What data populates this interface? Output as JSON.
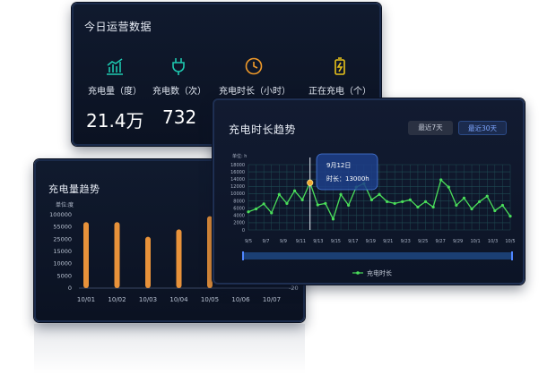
{
  "stats": {
    "title": "今日运营数据",
    "items": [
      {
        "icon": "bar-chart-icon",
        "label": "充电量（度）",
        "value": "21.4万",
        "color": "#1ec8b0"
      },
      {
        "icon": "plug-icon",
        "label": "充电数（次）",
        "value": "732",
        "color": "#1ec8b0"
      },
      {
        "icon": "clock-icon",
        "label": "充电时长（小时）",
        "value": "",
        "color": "#f09a2a"
      },
      {
        "icon": "battery-icon",
        "label": "正在充电（个）",
        "value": "",
        "color": "#e8c21a"
      }
    ]
  },
  "volume": {
    "title": "充电量趋势",
    "chart_data": {
      "type": "bar",
      "ylabel": "单位:度",
      "ylim": [
        0,
        100000
      ],
      "yticks": [
        "100000",
        "55000",
        "25000",
        "15000",
        "10000",
        "5000",
        "0"
      ],
      "categories": [
        "10/01",
        "10/02",
        "10/03",
        "10/04",
        "10/05",
        "10/06",
        "10/07"
      ],
      "values": [
        90000,
        90000,
        70000,
        80000,
        98000,
        0,
        0
      ],
      "bar_color": "#e8923a",
      "extra_label": "-20"
    }
  },
  "duration": {
    "title": "充电时长趋势",
    "btn_7": "最近7天",
    "btn_30": "最近30天",
    "legend": "充电时长",
    "tooltip_date": "9月12日",
    "tooltip_value": "时长：13000h",
    "chart_data": {
      "type": "line",
      "ylabel": "单位: h",
      "ylim": [
        0,
        18000
      ],
      "yticks": [
        0,
        2000,
        4000,
        6000,
        8000,
        10000,
        12000,
        14000,
        16000,
        18000
      ],
      "xticks": [
        "9/5",
        "9/7",
        "9/9",
        "9/11",
        "9/13",
        "9/15",
        "9/17",
        "9/19",
        "9/21",
        "9/23",
        "9/25",
        "9/27",
        "9/29",
        "10/1",
        "10/3",
        "10/5"
      ],
      "series": [
        {
          "name": "充电时长",
          "color": "#4ade5a",
          "values": [
            5000,
            5800,
            7200,
            4700,
            9800,
            7300,
            10800,
            8300,
            13000,
            6900,
            7300,
            3000,
            9800,
            6800,
            11800,
            12800,
            8300,
            9800,
            7800,
            7300,
            7800,
            8300,
            6300,
            7800,
            6300,
            13800,
            11800,
            6800,
            8800,
            5800,
            7800,
            9300,
            5300,
            6800,
            3800
          ]
        }
      ],
      "highlight_index": 8
    }
  }
}
